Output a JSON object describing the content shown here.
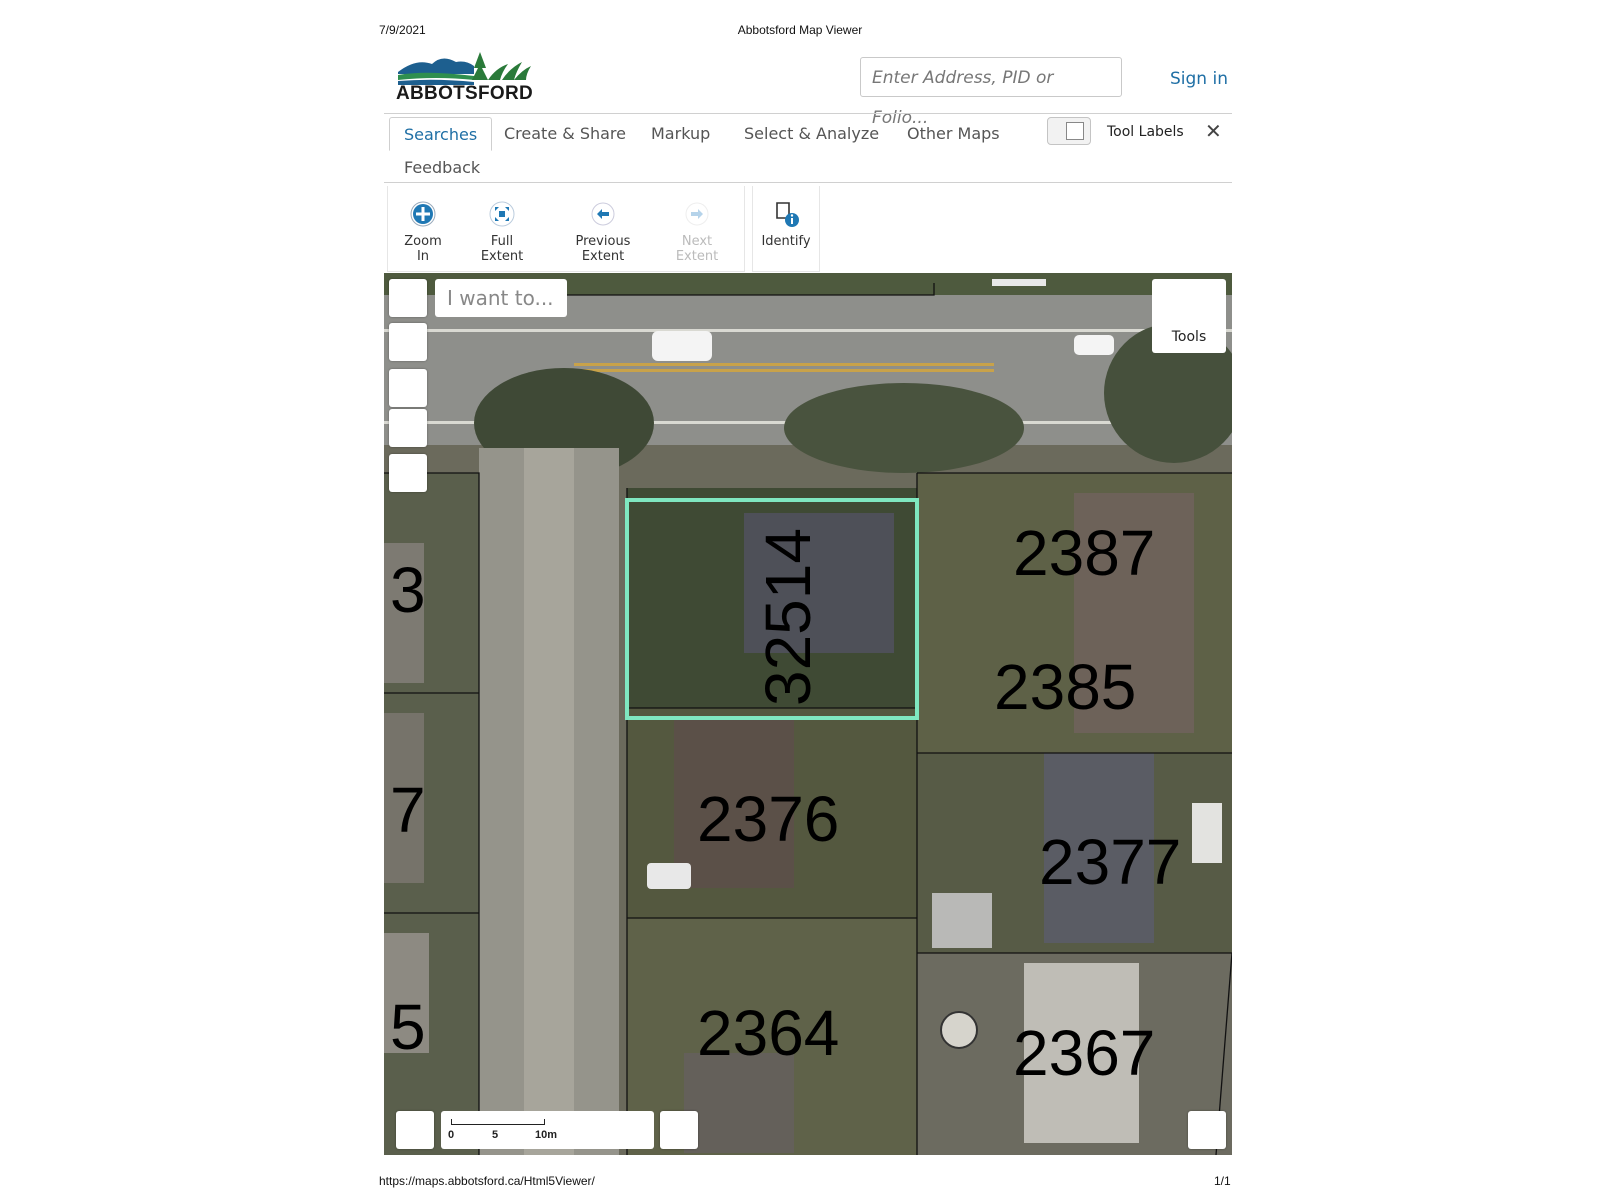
{
  "print_header": {
    "date": "7/9/2021",
    "title": "Abbotsford Map Viewer"
  },
  "print_footer": {
    "url": "https://maps.abbotsford.ca/Html5Viewer/",
    "page": "1/1"
  },
  "brand": {
    "name": "ABBOTSFORD",
    "colors": {
      "mountain": "#1d5f8f",
      "hills": "#2f8f4e",
      "trees": "#2a7a3a"
    }
  },
  "search": {
    "placeholder": "Enter Address, PID or Folio..."
  },
  "signin_label": "Sign in",
  "tabs": [
    {
      "label": "Searches",
      "active": true
    },
    {
      "label": "Create & Share"
    },
    {
      "label": "Markup"
    },
    {
      "label": "Select & Analyze"
    },
    {
      "label": "Other Maps"
    },
    {
      "label": "Feedback"
    }
  ],
  "tool_labels_toggle": {
    "label": "Tool Labels",
    "on": false
  },
  "close_symbol": "✕",
  "toolbar": {
    "navigation": [
      {
        "label": "Zoom In",
        "icon": "plus-circle-icon",
        "enabled": true
      },
      {
        "label": "Full Extent",
        "icon": "full-extent-icon",
        "enabled": true
      },
      {
        "label": "Previous Extent",
        "icon": "arrow-left-icon",
        "enabled": true
      },
      {
        "label": "Next Extent",
        "icon": "arrow-right-icon",
        "enabled": false
      }
    ],
    "identify": {
      "label": "Identify",
      "icon": "identify-icon"
    }
  },
  "map": {
    "i_want_to_placeholder": "I want to...",
    "tools_label": "Tools",
    "selection_color": "#7fe7c0",
    "parcels": [
      "32514",
      "2387",
      "2385",
      "2376",
      "2377",
      "2364",
      "2367",
      "3",
      "7",
      "5"
    ],
    "scale": {
      "ticks": [
        "0",
        "5",
        "10m"
      ]
    }
  }
}
